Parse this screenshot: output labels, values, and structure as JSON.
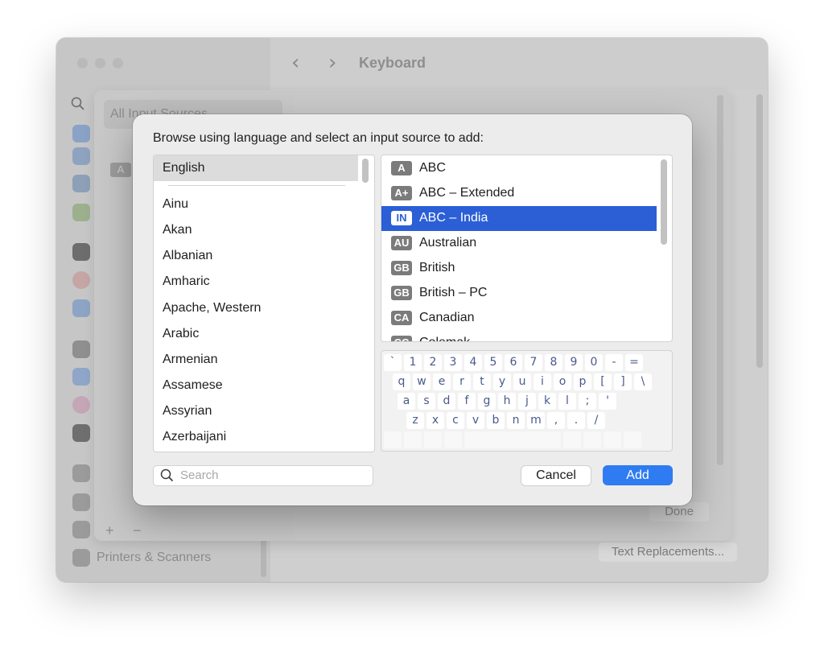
{
  "window": {
    "title": "Keyboard",
    "sidebar_bottom_item": "Printers & Scanners",
    "text_replacements_label": "Text Replacements...",
    "done_label": "Done",
    "add_label": "+",
    "remove_label": "−"
  },
  "sheet": {
    "list_header": "All Input Sources",
    "badge": "A"
  },
  "dialog": {
    "title": "Browse using language and select an input source to add:",
    "languages": {
      "selected": "English",
      "items": [
        "Ainu",
        "Akan",
        "Albanian",
        "Amharic",
        "Apache, Western",
        "Arabic",
        "Armenian",
        "Assamese",
        "Assyrian",
        "Azerbaijani"
      ]
    },
    "sources": [
      {
        "badge": "A",
        "label": "ABC"
      },
      {
        "badge": "A+",
        "label": "ABC – Extended"
      },
      {
        "badge": "IN",
        "label": "ABC – India"
      },
      {
        "badge": "AU",
        "label": "Australian"
      },
      {
        "badge": "GB",
        "label": "British"
      },
      {
        "badge": "GB",
        "label": "British – PC"
      },
      {
        "badge": "CA",
        "label": "Canadian"
      },
      {
        "badge": "CC",
        "label": "Colemak"
      }
    ],
    "selected_source": "ABC – India",
    "keyboard_rows": [
      [
        "`",
        "1",
        "2",
        "3",
        "4",
        "5",
        "6",
        "7",
        "8",
        "9",
        "0",
        "-",
        "="
      ],
      [
        "q",
        "w",
        "e",
        "r",
        "t",
        "y",
        "u",
        "i",
        "o",
        "p",
        "[",
        "]",
        "\\"
      ],
      [
        "a",
        "s",
        "d",
        "f",
        "g",
        "h",
        "j",
        "k",
        "l",
        ";",
        "'"
      ],
      [
        "z",
        "x",
        "c",
        "v",
        "b",
        "n",
        "m",
        ",",
        ".",
        "/"
      ]
    ],
    "search_placeholder": "Search",
    "cancel_label": "Cancel",
    "add_label": "Add"
  },
  "colors": {
    "accent": "#2f7bf2",
    "selection": "#2c5fd6"
  }
}
